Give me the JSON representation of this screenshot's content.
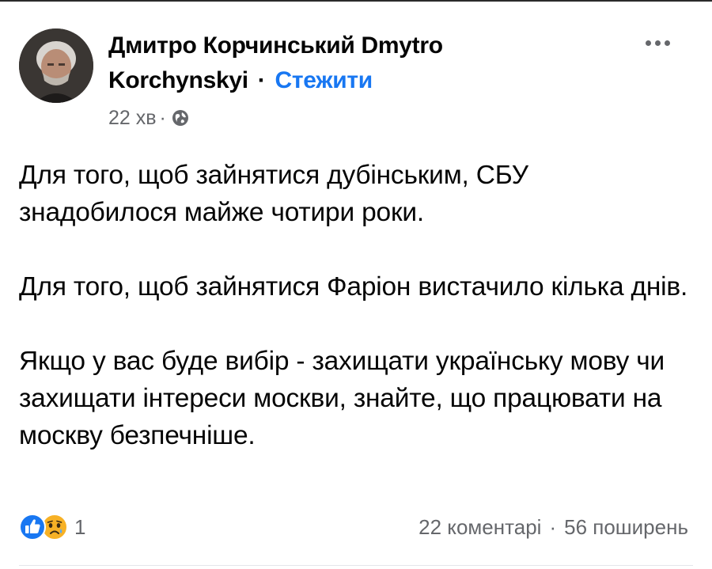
{
  "post": {
    "author_line1": "Дмитро Корчинський  Dmytro",
    "author_line2": "Korchynskyi",
    "separator": "·",
    "follow_label": "Стежити",
    "time": "22 хв",
    "meta_separator": "·",
    "privacy_icon": "globe-icon",
    "paragraphs": [
      "Для того, щоб зайнятися дубінським, СБУ знадобилося майже чотири роки.",
      "Для того, щоб зайнятися Фаріон вистачило кілька днів.",
      "Якщо у вас буде вибір - захищати українську мову чи захищати інтереси москви, знайте, що працювати на москву безпечніше."
    ]
  },
  "footer": {
    "reaction_icons": [
      "like-icon",
      "sad-icon"
    ],
    "reaction_count": "1",
    "comments": "22 коментарі",
    "stats_separator": "·",
    "shares": "56 поширень"
  },
  "colors": {
    "accent": "#1877f2",
    "secondary_text": "#65676b",
    "like_blue": "#1877f2",
    "sad_yellow": "#f7b125"
  }
}
